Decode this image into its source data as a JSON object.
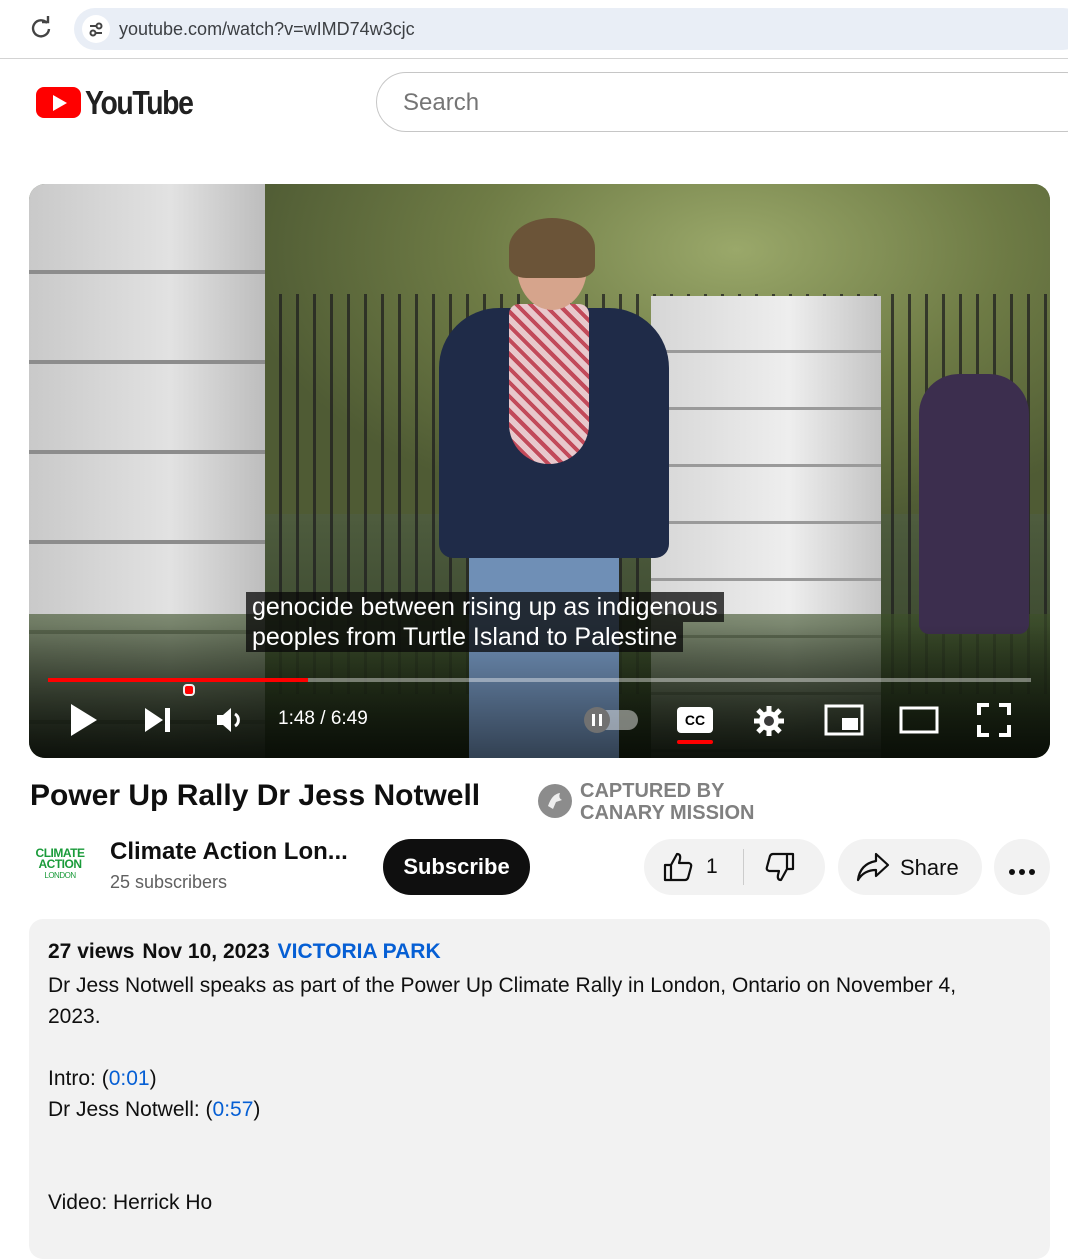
{
  "browser": {
    "url": "youtube.com/watch?v=wIMD74w3cjc"
  },
  "header": {
    "logo_text": "YouTube",
    "search_placeholder": "Search"
  },
  "player": {
    "caption_lines": [
      "genocide between rising up as indigenous",
      "peoples from Turtle Island to Palestine"
    ],
    "time_current": "1:48",
    "time_total": "6:49",
    "time_display": "1:48 / 6:49",
    "progress_fraction": 0.264,
    "captions_on": true,
    "colors": {
      "progress": "#ff0000"
    }
  },
  "video": {
    "title": "Power Up Rally Dr Jess Notwell",
    "watermark_line1": "CAPTURED BY",
    "watermark_line2": "CANARY MISSION"
  },
  "channel": {
    "avatar_line1": "CLIMATE",
    "avatar_line2": "ACTION",
    "avatar_line3": "LONDON",
    "name": "Climate Action Lon...",
    "subscribers": "25 subscribers",
    "subscribe_label": "Subscribe"
  },
  "actions": {
    "like_count": "1",
    "share_label": "Share"
  },
  "description": {
    "views": "27 views",
    "date": "Nov 10, 2023",
    "location": "VICTORIA PARK",
    "line1": "Dr Jess Notwell speaks as part of the Power Up Climate Rally in London, Ontario on November 4, 2023.",
    "intro_label": "Intro: (",
    "intro_ts": "0:01",
    "intro_close": ")",
    "speaker_label": "Dr Jess Notwell: (",
    "speaker_ts": "0:57",
    "speaker_close": ")",
    "credit": "Video: Herrick Ho"
  }
}
